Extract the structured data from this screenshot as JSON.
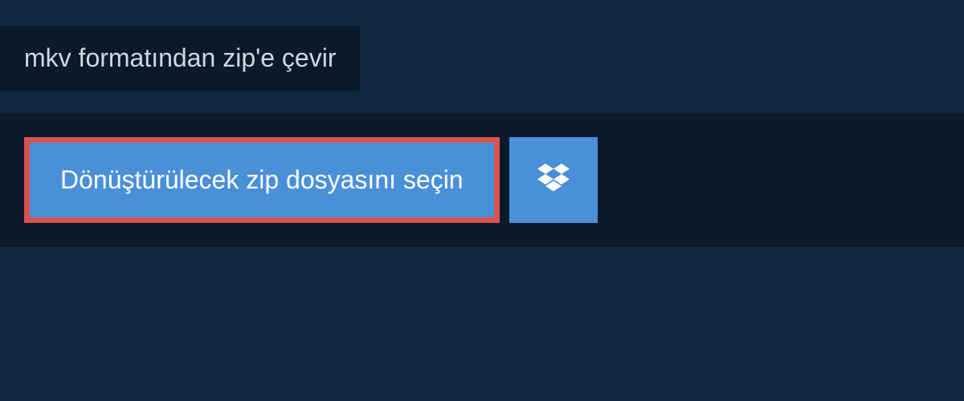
{
  "header": {
    "title": "mkv formatından zip'e çevir"
  },
  "actions": {
    "select_file_label": "Dönüştürülecek zip dosyasını seçin",
    "dropbox_icon_name": "dropbox-icon"
  },
  "colors": {
    "background": "#10283e",
    "panel": "#0a1a2a",
    "button": "#4a90d9",
    "highlight_border": "#d9534f"
  }
}
